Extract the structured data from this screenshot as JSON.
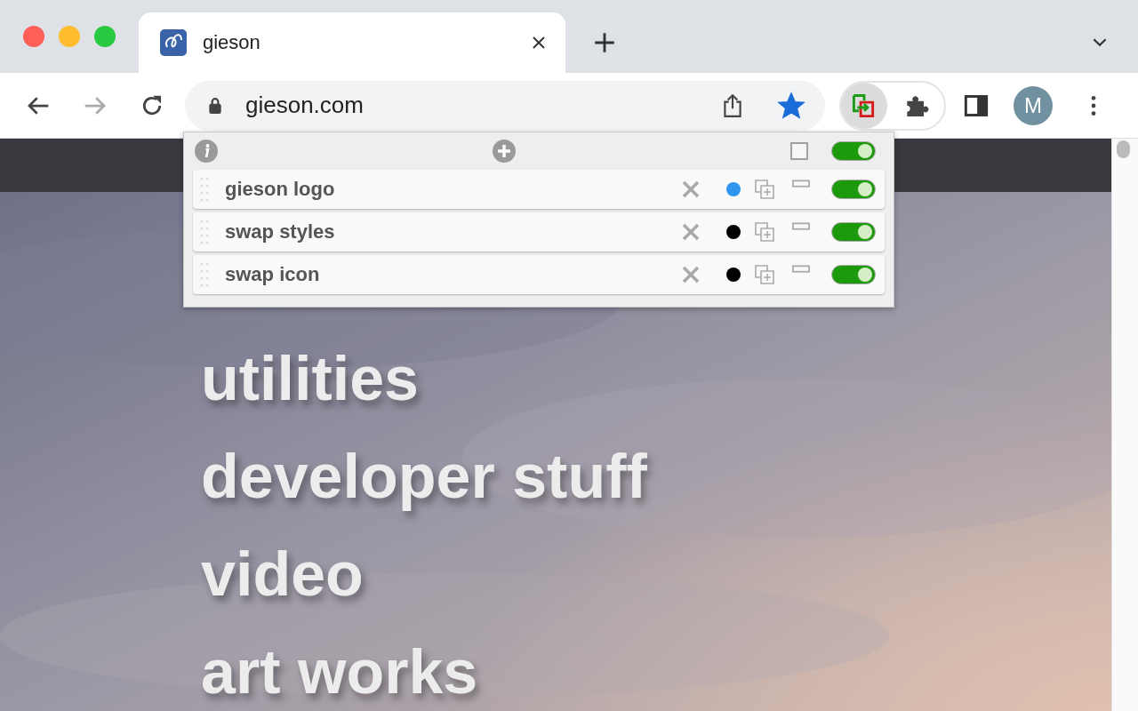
{
  "tabs": [
    {
      "title": "gieson",
      "selected": true
    }
  ],
  "toolbar": {
    "address": "gieson.com",
    "bookmarked": true,
    "profile": "M"
  },
  "popup": {
    "header": {
      "checked": false,
      "on": true
    },
    "rules": [
      {
        "name": "gieson logo",
        "color": "#2e96ee",
        "on": true
      },
      {
        "name": "swap styles",
        "color": "#000000",
        "on": true
      },
      {
        "name": "swap icon",
        "color": "#000000",
        "on": true
      }
    ]
  },
  "page": {
    "menu": [
      "utilities",
      "developer stuff",
      "video",
      "art works"
    ]
  }
}
